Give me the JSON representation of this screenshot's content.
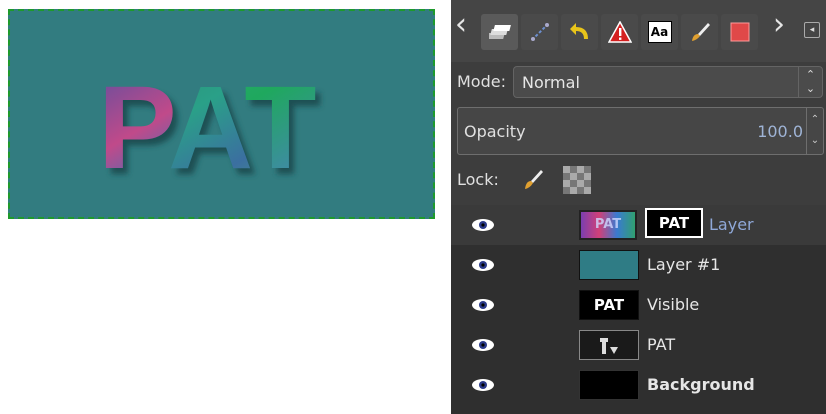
{
  "canvas": {
    "text": "PAT",
    "bg_color": "#327c80",
    "border_color": "#1e9a2c"
  },
  "tabs": [
    {
      "name": "layers-tab-icon",
      "active": true
    },
    {
      "name": "paths-tab-icon"
    },
    {
      "name": "undo-history-tab-icon"
    },
    {
      "name": "warning-tab-icon"
    },
    {
      "name": "fonts-tab-icon",
      "text": "Aa"
    },
    {
      "name": "brushes-tab-icon"
    },
    {
      "name": "patterns-tab-icon"
    }
  ],
  "mode": {
    "label": "Mode:",
    "value": "Normal"
  },
  "opacity": {
    "label": "Opacity",
    "value": "100.0"
  },
  "lock": {
    "label": "Lock:"
  },
  "layers": [
    {
      "name": "Layer",
      "mask_text": "PAT",
      "thumb_text": "PAT",
      "selected": true,
      "name_color": "#8fa8d8"
    },
    {
      "name": "Layer #1",
      "thumb_color": "#2f7c85"
    },
    {
      "name": "Visible",
      "thumb_text": "PAT"
    },
    {
      "name": "PAT"
    },
    {
      "name": "Background",
      "thumb_color": "#000000",
      "bold": true
    }
  ]
}
